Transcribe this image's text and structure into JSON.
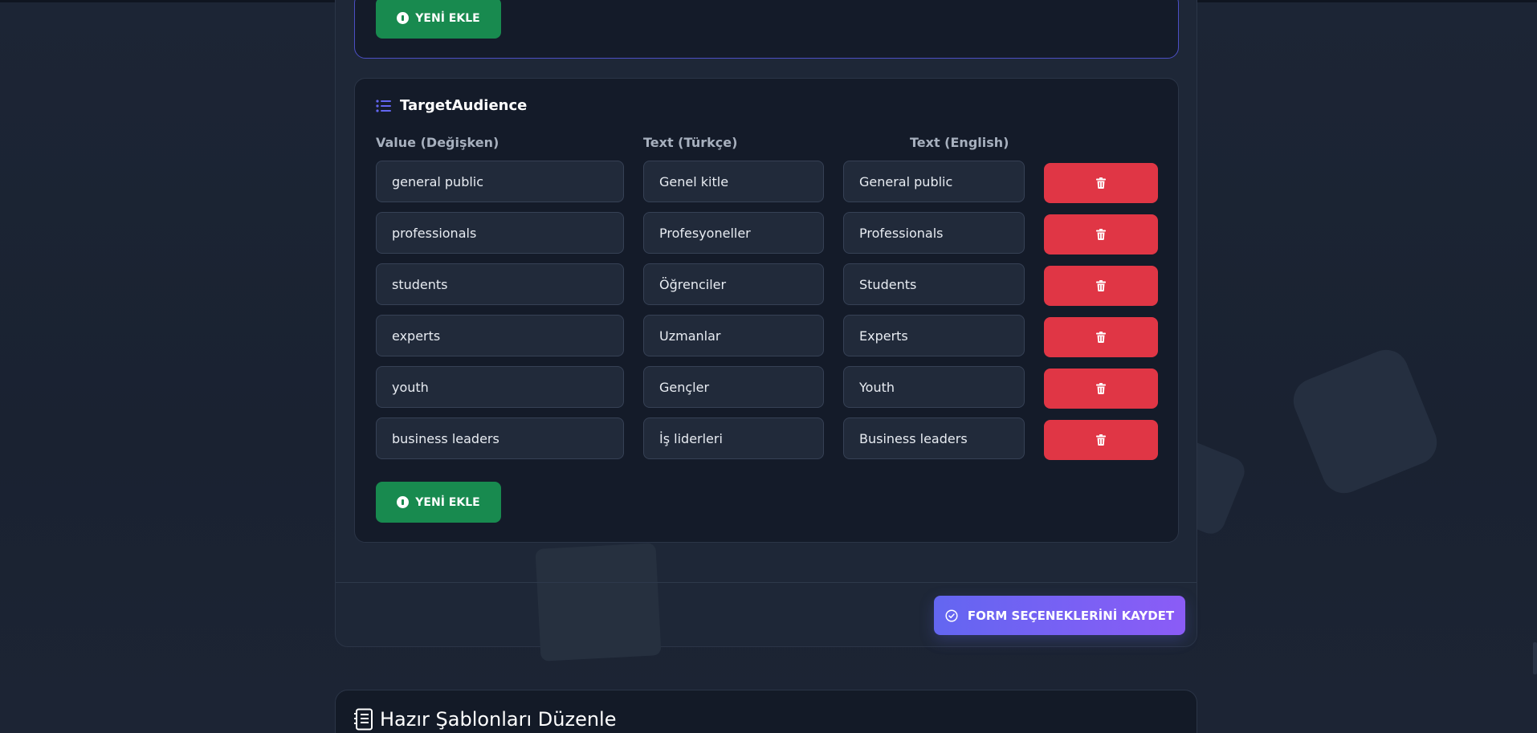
{
  "previous_section": {
    "add_button_label": "YENİ EKLE"
  },
  "section": {
    "title": "TargetAudience",
    "headers": {
      "value": "Value (Değişken)",
      "text_tr": "Text (Türkçe)",
      "text_en": "Text (English)"
    },
    "rows": [
      {
        "value": "general public",
        "text_tr": "Genel kitle",
        "text_en": "General public"
      },
      {
        "value": "professionals",
        "text_tr": "Profesyoneller",
        "text_en": "Professionals"
      },
      {
        "value": "students",
        "text_tr": "Öğrenciler",
        "text_en": "Students"
      },
      {
        "value": "experts",
        "text_tr": "Uzmanlar",
        "text_en": "Experts"
      },
      {
        "value": "youth",
        "text_tr": "Gençler",
        "text_en": "Youth"
      },
      {
        "value": "business leaders",
        "text_tr": "İş liderleri",
        "text_en": "Business leaders"
      }
    ],
    "add_button_label": "YENİ EKLE"
  },
  "save_button_label": "FORM SEÇENEKLERİNİ KAYDET",
  "next_card": {
    "title": "Hazır Şablonları Düzenle"
  },
  "colors": {
    "add_green": "#188a4f",
    "delete_red": "#e03645",
    "save_gradient_start": "#6366f1",
    "save_gradient_end": "#8b5cf6",
    "accent_border": "#4c4fc4"
  }
}
